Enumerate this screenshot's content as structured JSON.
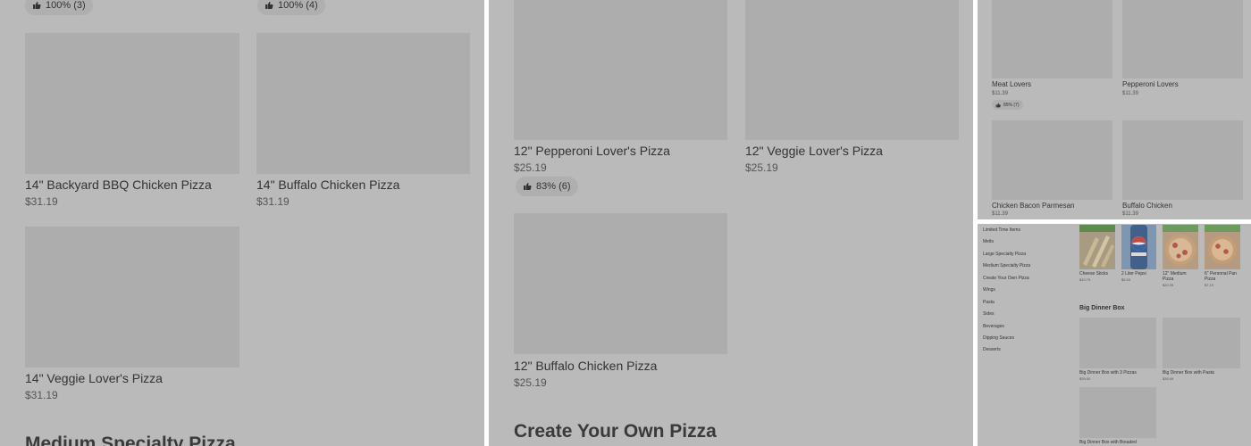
{
  "panel_a": {
    "top_ratings": [
      "100% (3)",
      "100% (4)"
    ],
    "items": [
      {
        "name": "14\" Backyard BBQ Chicken Pizza",
        "price": "$31.19"
      },
      {
        "name": "14\" Buffalo Chicken Pizza",
        "price": "$31.19"
      },
      {
        "name": "14\" Veggie Lover's Pizza",
        "price": "$31.19"
      }
    ],
    "next_heading": "Medium Specialty Pizza"
  },
  "panel_b": {
    "items": [
      {
        "name": "12\" Pepperoni Lover's Pizza",
        "price": "$25.19",
        "rating": "83% (6)"
      },
      {
        "name": "12\" Veggie Lover's Pizza",
        "price": "$25.19"
      },
      {
        "name": "12\" Buffalo Chicken Pizza",
        "price": "$25.19"
      }
    ],
    "next_heading": "Create Your Own Pizza"
  },
  "panel_c": {
    "items": [
      {
        "name": "Meat Lovers",
        "price": "$11.39",
        "rating": "85% (7)"
      },
      {
        "name": "Pepperoni Lovers",
        "price": "$11.39"
      },
      {
        "name": "Chicken Bacon Parmesan",
        "price": "$11.39"
      },
      {
        "name": "Buffalo Chicken",
        "price": "$11.39"
      }
    ]
  },
  "panel_d": {
    "nav": [
      "Limited Time Items",
      "Melts",
      "Large Specialty Pizza",
      "Medium Specialty Pizza",
      "Create Your Own Pizza",
      "Wings",
      "Pasta",
      "Sides",
      "Beverages",
      "Dipping Sauces",
      "Desserts"
    ],
    "thumbs": [
      {
        "name": "Cheese Sticks",
        "price": "$10.79"
      },
      {
        "name": "2 Liter Pepsi",
        "price": "$5.59"
      },
      {
        "name": "12\" Medium Pizza",
        "price": "$20.39"
      },
      {
        "name": "6\" Personal Pan Pizza",
        "price": "$7.19"
      }
    ],
    "section_heading": "Big Dinner Box",
    "boxes": [
      {
        "name": "Big Dinner Box with 3 Pizzas",
        "price": "$39.00"
      },
      {
        "name": "Big Dinner Box with Pasta",
        "price": "$35.99"
      },
      {
        "name": "Big Dinner Box with Breaded"
      }
    ]
  },
  "colors": {
    "overlay": "#bababa",
    "image_placeholder": "#adadad",
    "pill": "#afafaf"
  }
}
